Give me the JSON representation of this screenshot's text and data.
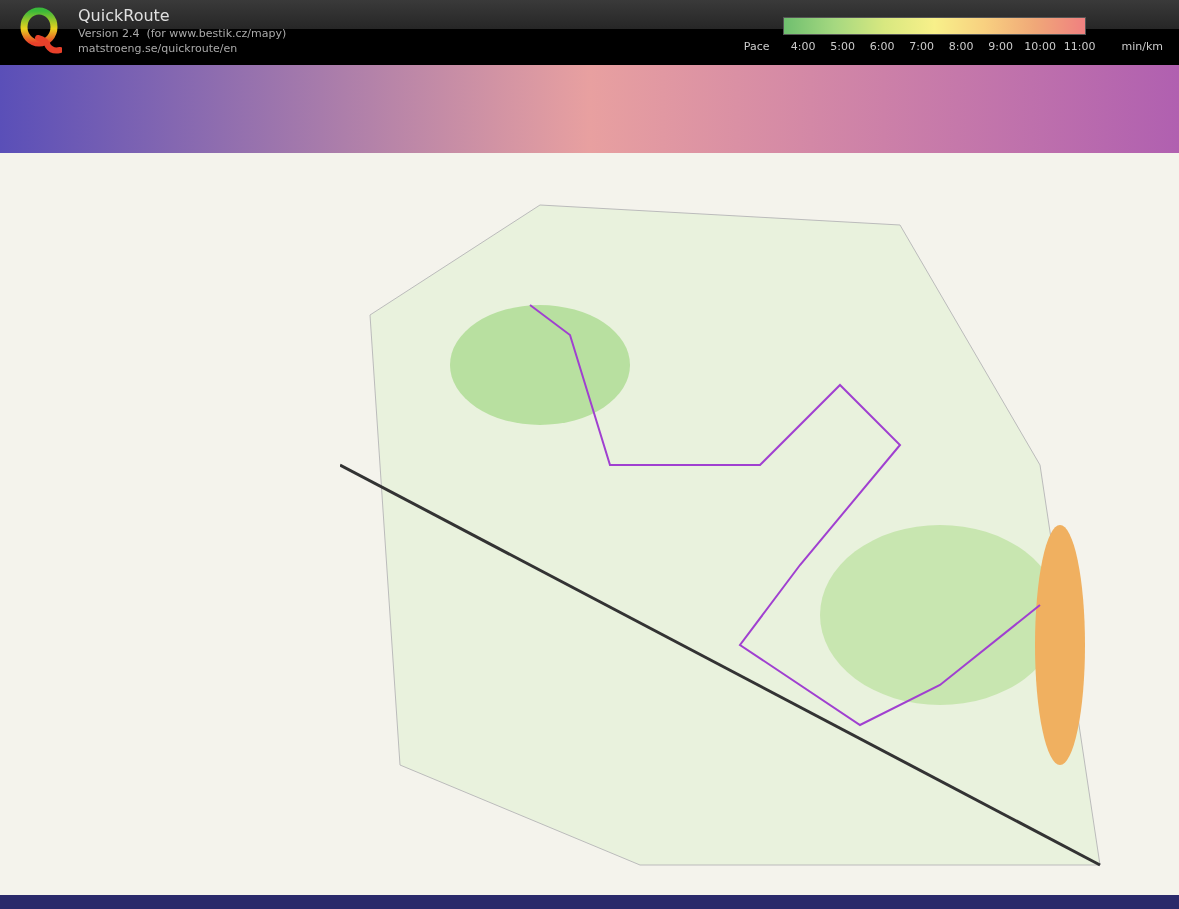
{
  "app": {
    "title": "QuickRoute",
    "version": "Version 2.4  (for www.bestik.cz/mapy)",
    "website": "matstroeng.se/quickroute/en"
  },
  "pace_legend": {
    "label": "Pace",
    "ticks": [
      "4:00",
      "5:00",
      "6:00",
      "7:00",
      "8:00",
      "9:00",
      "10:00",
      "11:00"
    ],
    "unit": "min/km"
  }
}
